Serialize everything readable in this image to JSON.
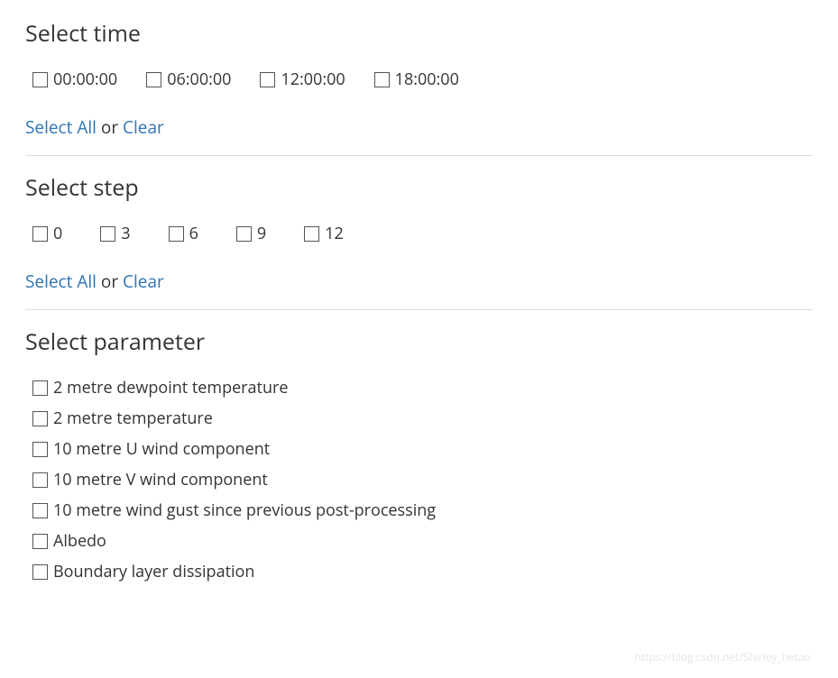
{
  "sections": {
    "time": {
      "heading": "Select time",
      "options": [
        "00:00:00",
        "06:00:00",
        "12:00:00",
        "18:00:00"
      ],
      "actions": {
        "select_all": "Select All",
        "sep": "or",
        "clear": "Clear"
      }
    },
    "step": {
      "heading": "Select step",
      "options": [
        "0",
        "3",
        "6",
        "9",
        "12"
      ],
      "actions": {
        "select_all": "Select All",
        "sep": "or",
        "clear": "Clear"
      }
    },
    "parameter": {
      "heading": "Select parameter",
      "options": [
        "2 metre dewpoint temperature",
        "2 metre temperature",
        "10 metre U wind component",
        "10 metre V wind component",
        "10 metre wind gust since previous post-processing",
        "Albedo",
        "Boundary layer dissipation"
      ]
    }
  },
  "watermark": "https://blog.csdn.net/Shirley_hetao"
}
